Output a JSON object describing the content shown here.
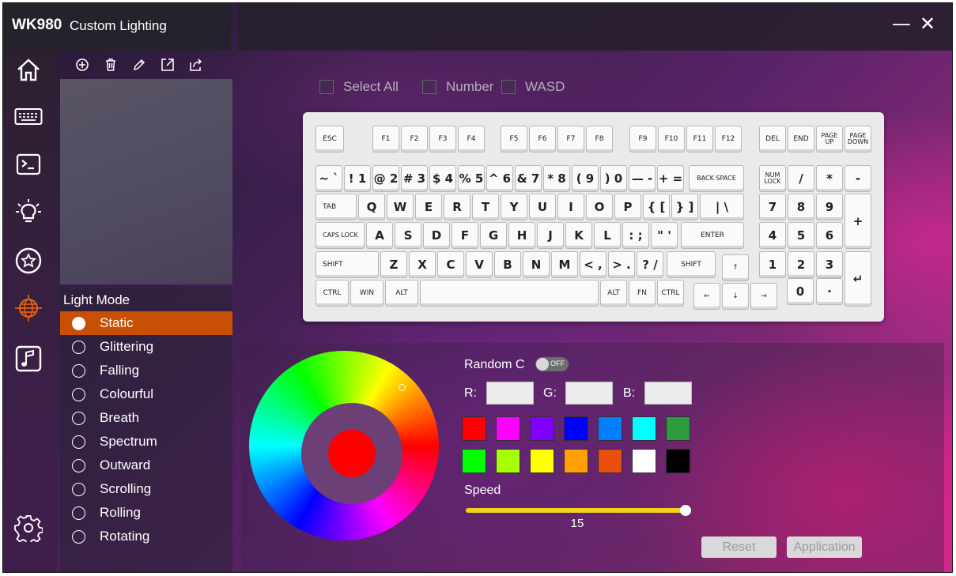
{
  "app": {
    "brand": "WK980",
    "title": "Custom Lighting"
  },
  "window_controls": {
    "minimize": "—",
    "close": "✕"
  },
  "nav": [
    "home-icon",
    "keyboard-icon",
    "macro-icon",
    "lighting-icon",
    "star-icon",
    "custom-light-icon",
    "music-icon",
    "settings-icon"
  ],
  "preset_toolbar": [
    "add-icon",
    "delete-icon",
    "edit-icon",
    "import-icon",
    "export-icon"
  ],
  "light_mode": {
    "title": "Light Mode",
    "selected": "Static",
    "modes": [
      "Static",
      "Glittering",
      "Falling",
      "Colourful",
      "Breath",
      "Spectrum",
      "Outward",
      "Scrolling",
      "Rolling",
      "Rotating"
    ]
  },
  "selection": {
    "select_all": "Select All",
    "number": "Number",
    "wasd": "WASD"
  },
  "keyboard": {
    "row0": [
      "ESC",
      "F1",
      "F2",
      "F3",
      "F4",
      "F5",
      "F6",
      "F7",
      "F8",
      "F9",
      "F10",
      "F11",
      "F12",
      "DEL",
      "END",
      "PAGE UP",
      "PAGE DOWN"
    ],
    "row1": [
      "~ `",
      "! 1",
      "@ 2",
      "# 3",
      "$ 4",
      "% 5",
      "^ 6",
      "& 7",
      "* 8",
      "( 9",
      ") 0",
      "— -",
      "+ =",
      "BACK SPACE",
      "NUM LOCK",
      "/",
      "*",
      "-"
    ],
    "row2": [
      "TAB",
      "Q",
      "W",
      "E",
      "R",
      "T",
      "Y",
      "U",
      "I",
      "O",
      "P",
      "{ [",
      "} ]",
      "| \\",
      "7",
      "8",
      "9",
      "+"
    ],
    "row3": [
      "CAPS LOCK",
      "A",
      "S",
      "D",
      "F",
      "G",
      "H",
      "J",
      "K",
      "L",
      ": ;",
      "\" '",
      "ENTER",
      "4",
      "5",
      "6"
    ],
    "row4": [
      "SHIFT",
      "Z",
      "X",
      "C",
      "V",
      "B",
      "N",
      "M",
      "< ,",
      "> .",
      "? /",
      "SHIFT",
      "↑",
      "1",
      "2",
      "3",
      "↵"
    ],
    "row5": [
      "CTRL",
      "WIN",
      "ALT",
      "",
      "ALT",
      "FN",
      "CTRL",
      "←",
      "↓",
      "→",
      "0",
      "·"
    ]
  },
  "color": {
    "random_label": "Random C",
    "random_state": "OFF",
    "r_label": "R:",
    "g_label": "G:",
    "b_label": "B:",
    "r_value": "",
    "g_value": "",
    "b_value": "",
    "current": "#ff0000",
    "swatches": [
      "#ff0000",
      "#ff00ff",
      "#8000ff",
      "#0000ff",
      "#0080ff",
      "#00ffff",
      "#2e9c3a",
      "#00ff00",
      "#a8ff00",
      "#ffff00",
      "#ffa000",
      "#e84f0c",
      "#ffffff",
      "#000000"
    ]
  },
  "speed": {
    "label": "Speed",
    "value": "15",
    "fraction": 0.98
  },
  "buttons": {
    "reset": "Reset",
    "apply": "Application"
  },
  "accent": "#c94f05"
}
